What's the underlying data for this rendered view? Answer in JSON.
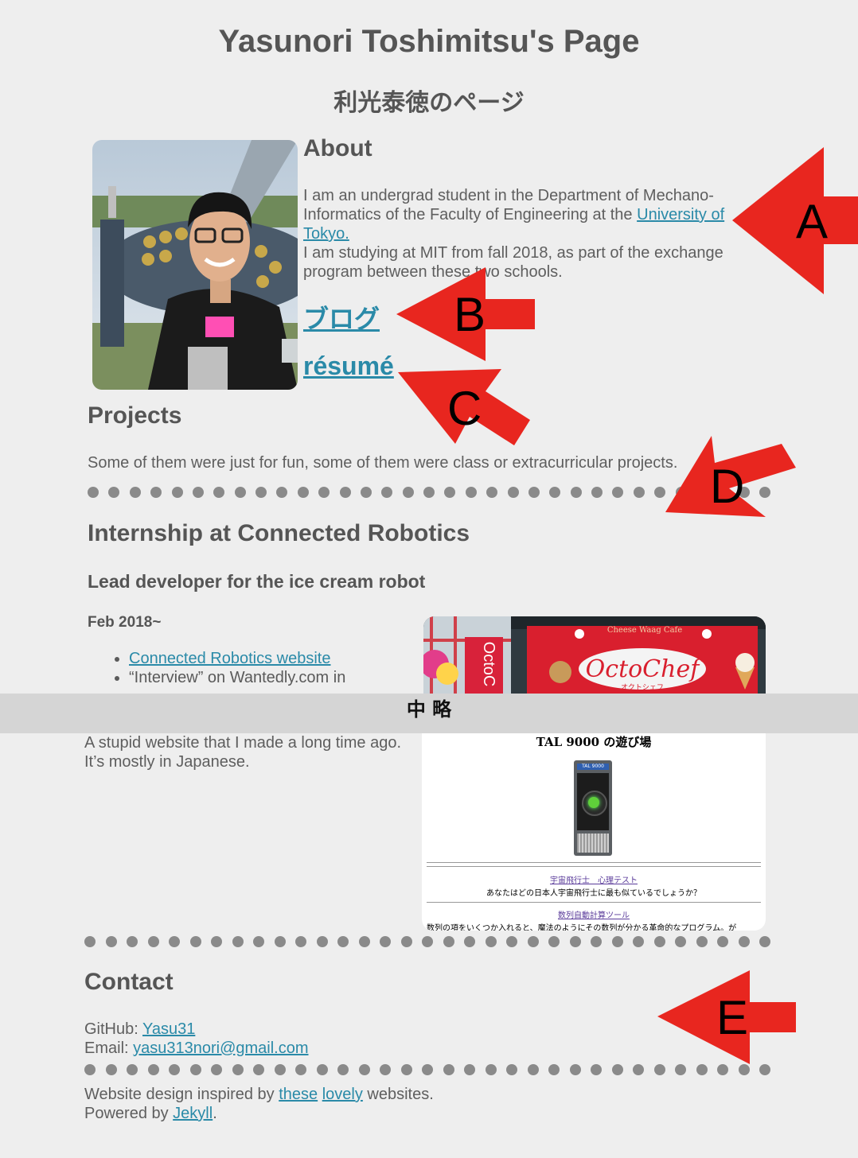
{
  "header": {
    "title": "Yasunori Toshimitsu's Page",
    "subtitle": "利光泰徳のページ"
  },
  "about": {
    "heading": "About",
    "line1": "I am an undergrad student in the Department of Mechano-",
    "line2_prefix": "Informatics of the Faculty of Engineering at the ",
    "university_link_part1": "University of",
    "university_link_part2": "Tokyo.",
    "line4": "I am studying at MIT from fall 2018, as part of the exchange",
    "line5": "program between these two schools.",
    "blog_link": "ブログ",
    "resume_link": "résumé"
  },
  "projects": {
    "heading": "Projects",
    "intro": "Some of them were just for fun, some of them were class or extracurricular projects."
  },
  "internship": {
    "heading": "Internship at Connected Robotics",
    "subheading": "Lead developer for the ice cream robot",
    "date": "Feb 2018~",
    "links": [
      {
        "text": "Connected Robotics website"
      },
      {
        "text": "“Interview” on Wantedly.com in"
      }
    ],
    "photo": {
      "sign_small": "Cheese Waag Cafe",
      "sign_main": "OctoChef",
      "sign_kana": "オクトシェフ",
      "banner": "OctoC"
    }
  },
  "omitted_label": "中 略",
  "old_site": {
    "desc_line1": "A stupid website that I made a long time ago.",
    "desc_line2": "It’s mostly in Japanese.",
    "screenshot": {
      "title": "TAL 9000 の遊び場",
      "badge": "TAL 9000",
      "link1": "宇宙飛行士　心理テスト",
      "text1": "あなたはどの日本人宇宙飛行士に最も似ているでしょうか？",
      "link2": "数列自動計算ツール",
      "text2": "数列の項をいくつか入れると、魔法のようにその数列が分かる革命的なプログラム。が"
    }
  },
  "contact": {
    "heading": "Contact",
    "github_label": "GitHub: ",
    "github_link": "Yasu31",
    "email_label": "Email: ",
    "email_link": "yasu313nori@gmail.com"
  },
  "footer": {
    "design_prefix": "Website design inspired by ",
    "these_link": "these",
    "lovely_link": "lovely",
    "design_suffix": " websites.",
    "powered_prefix": "Powered by ",
    "jekyll_link": "Jekyll",
    "powered_suffix": "."
  },
  "annotations": {
    "color": "#e8261f",
    "labels": [
      "A",
      "B",
      "C",
      "D",
      "E"
    ]
  },
  "dots_color": "#8a8a8a",
  "link_color": "#2a8aa8",
  "background_color": "#eeeeee"
}
